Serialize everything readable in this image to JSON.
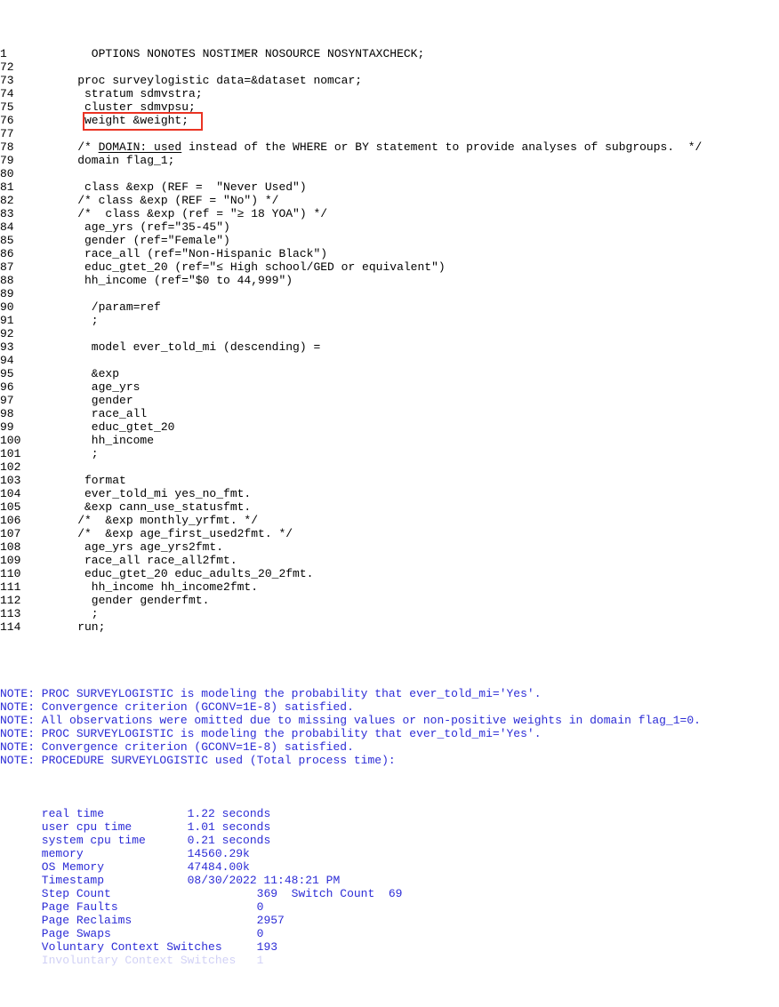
{
  "document": {
    "kind": "sas-log",
    "colors": {
      "background": "#ffffff",
      "code_text": "#000000",
      "note_text": "#2c2cd6",
      "annotation_box": "#ea3323"
    }
  },
  "annotation": {
    "name": "red-highlight-box",
    "targets_line": "79",
    "targets_text": "domain flag_1;"
  },
  "code_lines": [
    {
      "num": "1",
      "text": "      OPTIONS NONOTES NOSTIMER NOSOURCE NOSYNTAXCHECK;"
    },
    {
      "num": "72",
      "text": ""
    },
    {
      "num": "73",
      "text": "    proc surveylogistic data=&dataset nomcar;"
    },
    {
      "num": "74",
      "text": "     stratum sdmvstra;"
    },
    {
      "num": "75",
      "text": "     cluster sdmvpsu;"
    },
    {
      "num": "76",
      "text": "     weight &weight;"
    },
    {
      "num": "77",
      "text": ""
    },
    {
      "num": "78",
      "pre": "    /* ",
      "underlined": "DOMAIN: used",
      "post": " instead of the WHERE or BY statement to provide analyses of subgroups.  */"
    },
    {
      "num": "79",
      "text": "    domain flag_1;"
    },
    {
      "num": "80",
      "text": ""
    },
    {
      "num": "81",
      "text": "     class &exp (REF =  \"Never Used\")"
    },
    {
      "num": "82",
      "text": "    /* class &exp (REF = \"No\") */"
    },
    {
      "num": "83",
      "text": "    /*  class &exp (ref = \"≥ 18 YOA\") */"
    },
    {
      "num": "84",
      "text": "     age_yrs (ref=\"35-45\")"
    },
    {
      "num": "85",
      "text": "     gender (ref=\"Female\")"
    },
    {
      "num": "86",
      "text": "     race_all (ref=\"Non-Hispanic Black\")"
    },
    {
      "num": "87",
      "text": "     educ_gtet_20 (ref=\"≤ High school/GED or equivalent\")"
    },
    {
      "num": "88",
      "text": "     hh_income (ref=\"$0 to 44,999\")"
    },
    {
      "num": "89",
      "text": ""
    },
    {
      "num": "90",
      "text": "      /param=ref"
    },
    {
      "num": "91",
      "text": "      ;"
    },
    {
      "num": "92",
      "text": ""
    },
    {
      "num": "93",
      "text": "      model ever_told_mi (descending) ="
    },
    {
      "num": "94",
      "text": ""
    },
    {
      "num": "95",
      "text": "      &exp"
    },
    {
      "num": "96",
      "text": "      age_yrs"
    },
    {
      "num": "97",
      "text": "      gender"
    },
    {
      "num": "98",
      "text": "      race_all"
    },
    {
      "num": "99",
      "text": "      educ_gtet_20"
    },
    {
      "num": "100",
      "text": "      hh_income"
    },
    {
      "num": "101",
      "text": "      ;"
    },
    {
      "num": "102",
      "text": ""
    },
    {
      "num": "103",
      "text": "     format"
    },
    {
      "num": "104",
      "text": "     ever_told_mi yes_no_fmt."
    },
    {
      "num": "105",
      "text": "     &exp cann_use_statusfmt."
    },
    {
      "num": "106",
      "text": "    /*  &exp monthly_yrfmt. */"
    },
    {
      "num": "107",
      "text": "    /*  &exp age_first_used2fmt. */"
    },
    {
      "num": "108",
      "text": "     age_yrs age_yrs2fmt."
    },
    {
      "num": "109",
      "text": "     race_all race_all2fmt."
    },
    {
      "num": "110",
      "text": "     educ_gtet_20 educ_adults_20_2fmt."
    },
    {
      "num": "111",
      "text": "      hh_income hh_income2fmt."
    },
    {
      "num": "112",
      "text": "      gender genderfmt."
    },
    {
      "num": "113",
      "text": "      ;"
    },
    {
      "num": "114",
      "text": "    run;"
    }
  ],
  "blank_separator_lines": 1,
  "notes": [
    "NOTE: PROC SURVEYLOGISTIC is modeling the probability that ever_told_mi='Yes'.",
    "NOTE: Convergence criterion (GCONV=1E-8) satisfied.",
    "NOTE: All observations were omitted due to missing values or non-positive weights in domain flag_1=0.",
    "NOTE: PROC SURVEYLOGISTIC is modeling the probability that ever_told_mi='Yes'.",
    "NOTE: Convergence criterion (GCONV=1E-8) satisfied.",
    "NOTE: PROCEDURE SURVEYLOGISTIC used (Total process time):"
  ],
  "statistics": [
    {
      "label": "real time",
      "value": "1.22 seconds"
    },
    {
      "label": "user cpu time",
      "value": "1.01 seconds"
    },
    {
      "label": "system cpu time",
      "value": "0.21 seconds"
    },
    {
      "label": "memory",
      "value": "14560.29k"
    },
    {
      "label": "OS Memory",
      "value": "47484.00k"
    },
    {
      "label": "Timestamp",
      "value": "08/30/2022 11:48:21 PM"
    },
    {
      "label": "Step Count",
      "value": "369",
      "extra_label": "Switch Count",
      "extra_value": "69"
    },
    {
      "label": "Page Faults",
      "value": "0"
    },
    {
      "label": "Page Reclaims",
      "value": "2957"
    },
    {
      "label": "Page Swaps",
      "value": "0"
    },
    {
      "label": "Voluntary Context Switches",
      "value": "193"
    }
  ],
  "statistics_raw": [
    "      real time            1.22 seconds",
    "      user cpu time        1.01 seconds",
    "      system cpu time      0.21 seconds",
    "      memory               14560.29k",
    "      OS Memory            47484.00k",
    "      Timestamp            08/30/2022 11:48:21 PM",
    "      Step Count                     369  Switch Count  69",
    "      Page Faults                    0",
    "      Page Reclaims                  2957",
    "      Page Swaps                     0",
    "      Voluntary Context Switches     193",
    "      Involuntary Context Switches   1"
  ]
}
